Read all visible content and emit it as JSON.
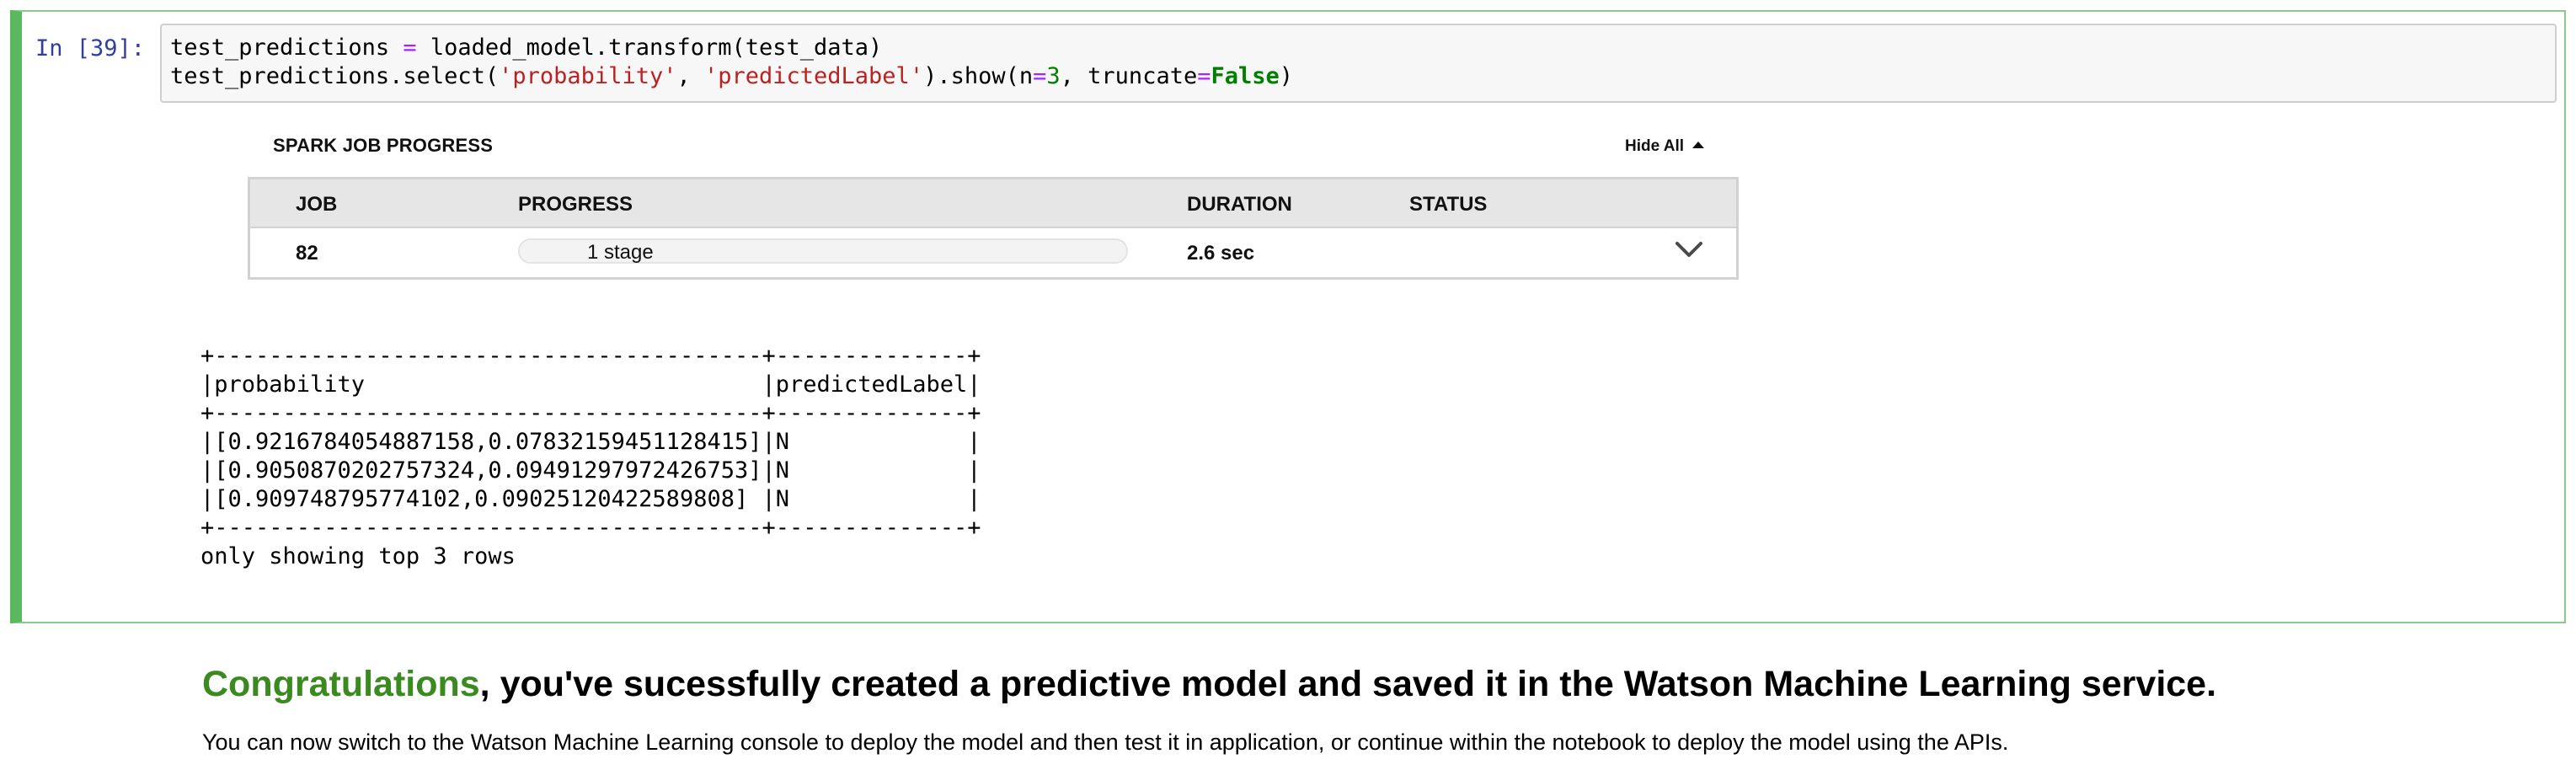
{
  "cell": {
    "prompt": "In [39]:",
    "code_line1": {
      "a": "test_predictions ",
      "op": "=",
      "b": " loaded_model.transform(test_data)"
    },
    "code_line2": {
      "a": "test_predictions.select(",
      "s1": "'probability'",
      "c": ", ",
      "s2": "'predictedLabel'",
      "d": ").show(n",
      "op1": "=",
      "n": "3",
      "e": ", truncate",
      "op2": "=",
      "kw": "False",
      "f": ")"
    }
  },
  "spark": {
    "title": "SPARK JOB PROGRESS",
    "hide_all": "Hide All",
    "headers": {
      "job": "JOB",
      "progress": "PROGRESS",
      "duration": "DURATION",
      "status": "STATUS"
    },
    "row": {
      "job": "82",
      "progress_label": "1 stage",
      "progress_fraction": 1.0,
      "duration": "2.6 sec",
      "status": ""
    },
    "icons": {
      "expand": "chevron-down-icon",
      "hide": "triangle-up-icon"
    }
  },
  "output": {
    "text": "+----------------------------------------+--------------+\n|probability                             |predictedLabel|\n+----------------------------------------+--------------+\n|[0.9216784054887158,0.07832159451128415]|N             |\n|[0.9050870202757324,0.09491297972426753]|N             |\n|[0.909748795774102,0.09025120422589808] |N             |\n+----------------------------------------+--------------+\nonly showing top 3 rows"
  },
  "markdown": {
    "heading_green": "Congratulations",
    "heading_rest": ", you've sucessfully created a predictive model and saved it in the Watson Machine Learning service.",
    "paragraph": "You can now switch to the Watson Machine Learning console to deploy the model and then test it in application, or continue within the notebook to deploy the model using the APIs."
  },
  "colors": {
    "cell_border": "#5cb85c",
    "heading_accent": "#3a8a1f",
    "prompt": "#303f9f"
  }
}
